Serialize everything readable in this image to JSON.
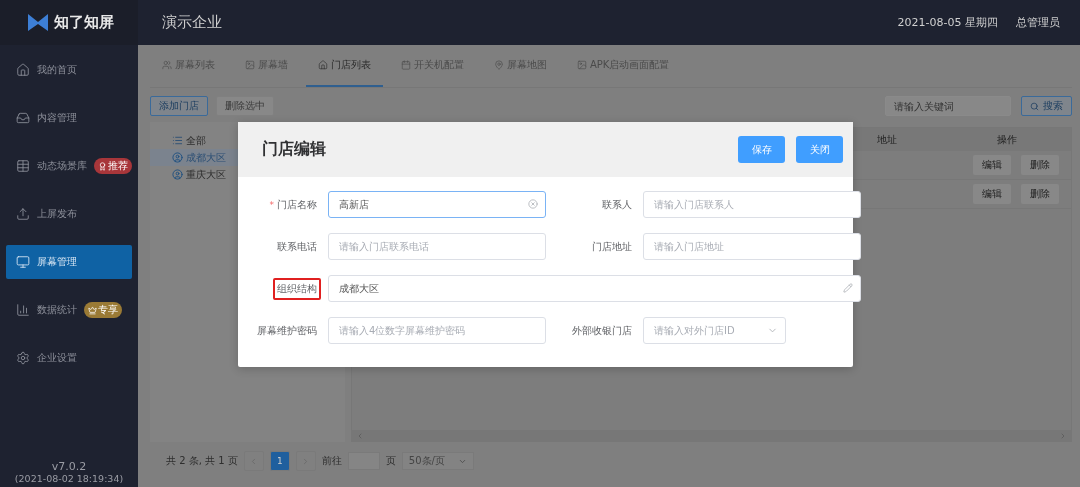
{
  "brand": {
    "name": "知了知屏"
  },
  "header": {
    "company": "演示企业",
    "date": "2021-08-05 星期四",
    "user": "总管理员"
  },
  "sidebar": {
    "items": [
      {
        "label": "我的首页",
        "selected": false
      },
      {
        "label": "内容管理",
        "selected": false
      },
      {
        "label": "动态场景库",
        "selected": false,
        "badge": {
          "text": "推荐",
          "kind": "hot"
        }
      },
      {
        "label": "上屏发布",
        "selected": false
      },
      {
        "label": "屏幕管理",
        "selected": true
      },
      {
        "label": "数据统计",
        "selected": false,
        "badge": {
          "text": "专享",
          "kind": "vip"
        }
      },
      {
        "label": "企业设置",
        "selected": false
      }
    ],
    "version": "v7.0.2",
    "build": "(2021-08-02 18:19:34)"
  },
  "tabs": [
    {
      "label": "屏幕列表",
      "selected": false
    },
    {
      "label": "屏幕墙",
      "selected": false
    },
    {
      "label": "门店列表",
      "selected": true
    },
    {
      "label": "开关机配置",
      "selected": false
    },
    {
      "label": "屏幕地图",
      "selected": false
    },
    {
      "label": "APK启动画面配置",
      "selected": false
    }
  ],
  "toolbar": {
    "add_button": "添加门店",
    "delete_button": {
      "label": "删除选中",
      "disabled": true
    },
    "search": {
      "placeholder": "请输入关键词"
    },
    "search_button": "搜索"
  },
  "tree": [
    {
      "label": "全部",
      "kind": "all",
      "selected": false
    },
    {
      "label": "成都大区",
      "kind": "region",
      "selected": true
    },
    {
      "label": "重庆大区",
      "kind": "region",
      "selected": false
    }
  ],
  "table": {
    "columns": [
      "地址",
      "操作"
    ],
    "rows": [
      {
        "actions": [
          "编辑",
          "删除"
        ]
      },
      {
        "actions": [
          "编辑",
          "删除"
        ]
      }
    ]
  },
  "pagination": {
    "summary": "共 2 条, 共 1 页",
    "pages": [
      {
        "label": "1",
        "selected": true
      }
    ],
    "goto_label": "前往",
    "page_unit": "页",
    "page_size": "50条/页"
  },
  "modal": {
    "title": "门店编辑",
    "required_mark": "*",
    "buttons": [
      "保存",
      "关闭"
    ],
    "fields": [
      {
        "label": "门店名称",
        "kind": "text",
        "required": true,
        "focused": true,
        "highlighted": false,
        "value": "高新店"
      },
      {
        "label": "联系人",
        "kind": "text",
        "required": false,
        "focused": false,
        "highlighted": false,
        "placeholder": "请输入门店联系人"
      },
      {
        "label": "联系电话",
        "kind": "text",
        "required": false,
        "focused": false,
        "highlighted": false,
        "placeholder": "请输入门店联系电话"
      },
      {
        "label": "门店地址",
        "kind": "text",
        "required": false,
        "focused": false,
        "highlighted": false,
        "placeholder": "请输入门店地址"
      },
      {
        "label": "组织结构",
        "kind": "tree",
        "required": false,
        "focused": false,
        "highlighted": true,
        "value": "成都大区"
      },
      {
        "label": "屏幕维护密码",
        "kind": "text",
        "required": false,
        "focused": false,
        "highlighted": false,
        "placeholder": "请输入4位数字屏幕维护密码"
      },
      {
        "label": "外部收银门店",
        "kind": "select",
        "required": false,
        "focused": false,
        "highlighted": false,
        "placeholder": "请输入对外门店ID"
      }
    ]
  }
}
